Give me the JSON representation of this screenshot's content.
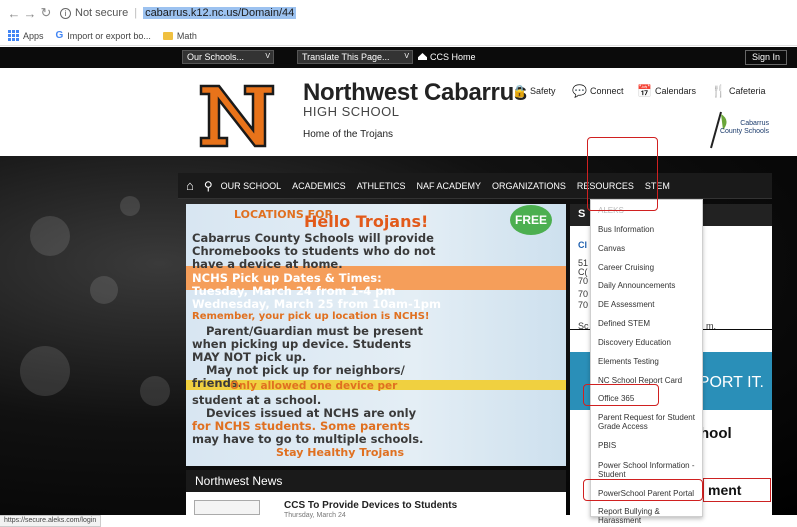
{
  "browser": {
    "not_secure": "Not secure",
    "separator": "|",
    "url": "cabarrus.k12.nc.us/Domain/44",
    "status_url": "https://secure.aleks.com/login"
  },
  "bookmarks": [
    {
      "label": "Apps"
    },
    {
      "label": "Import or export bo..."
    },
    {
      "label": "Math"
    }
  ],
  "top_strip": {
    "schools_select": "Our Schools...",
    "translate_select": "Translate This Page...",
    "select_caret": "V",
    "ccs_home": "CCS Home",
    "sign_in": "Sign In"
  },
  "header": {
    "logo_letter": "N",
    "school_name": "Northwest Cabarrus",
    "school_sub": "HIGH SCHOOL",
    "tagline": "Home of the Trojans",
    "links": [
      "Safety",
      "Connect",
      "Calendars",
      "Cafeteria"
    ],
    "district_logo_line1": "Cabarrus",
    "district_logo_line2": "County Schools"
  },
  "navbar": {
    "items": [
      "OUR SCHOOL",
      "ACADEMICS",
      "ATHLETICS",
      "NAF ACADEMY",
      "ORGANIZATIONS",
      "RESOURCES",
      "STEM"
    ]
  },
  "flyer": {
    "locations_title": "LOCATIONS FOR",
    "headline": "Hello Trojans!",
    "free_badge": "FREE",
    "lines": [
      "Cabarrus County Schools will provide",
      "Chromebooks to students who do not",
      "have a device at home.",
      "NCHS Pick up Dates & Times:",
      "Tuesday, March 24 from 1-4 pm",
      "Wednesday, March 25 from 10am-1pm",
      "Remember, your pick up location is NCHS!",
      "Parent/Guardian must be present",
      "when picking up device. Students",
      "MAY NOT pick up.",
      "May not pick up for neighbors/",
      "friends.",
      "Only allowed one device per",
      "student at a school.",
      "Devices issued at NCHS are only",
      "for NCHS students. Some parents",
      "may have to go to multiple schools.",
      "Stay Healthy Trojans"
    ]
  },
  "sidebar": {
    "letter": "S",
    "lines": [
      "Cl",
      "51",
      "C(",
      "70",
      "70",
      "70",
      "Sc",
      "m."
    ],
    "report_label": "REPORT IT.",
    "school_word": "hool",
    "ment_word": "ment"
  },
  "resources_menu": {
    "items": [
      "ALEKS",
      "Bus Information",
      "Canvas",
      "Career Cruising",
      "Daily Announcements",
      "DE Assessment",
      "Defined STEM",
      "Discovery Education",
      "Elements Testing",
      "NC School Report Card",
      "Office 365",
      "Parent Request for Student Grade Access",
      "PBIS",
      "Power School Information - Student",
      "PowerSchool Parent Portal",
      "Report Bullying & Harassment"
    ]
  },
  "news": {
    "heading": "Northwest News",
    "title": "CCS To Provide Devices to Students",
    "date": "Thursday, March 24"
  },
  "colors": {
    "nav_bg": "#1a1a1a",
    "logo_orange": "#e8731a",
    "annotation_red": "#d02020",
    "report_blue": "#2a8fb8"
  }
}
